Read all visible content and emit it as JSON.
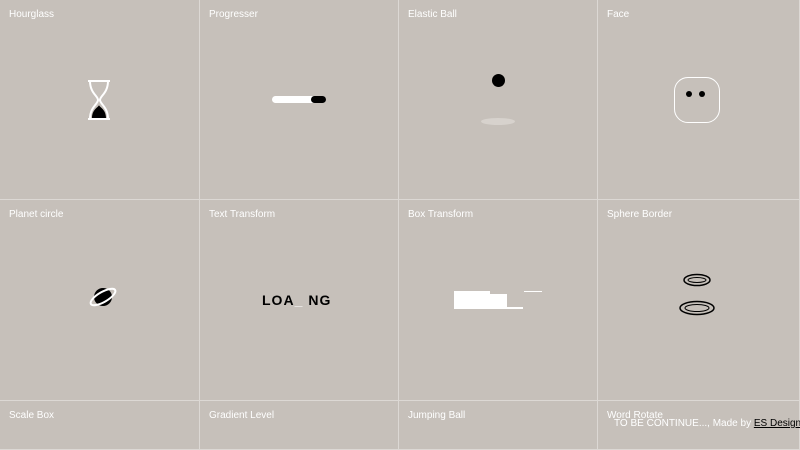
{
  "cells": [
    {
      "label": "Hourglass"
    },
    {
      "label": "Progresser"
    },
    {
      "label": "Elastic Ball"
    },
    {
      "label": "Face"
    },
    {
      "label": "Planet circle"
    },
    {
      "label": "Text Transform"
    },
    {
      "label": "Box Transform"
    },
    {
      "label": "Sphere Border"
    },
    {
      "label": "Scale Box"
    },
    {
      "label": "Gradient Level"
    },
    {
      "label": "Jumping Ball"
    },
    {
      "label": "Word Rotate"
    }
  ],
  "text_transform": {
    "left": "LOA",
    "under": "_",
    "right": "NG"
  },
  "footer": {
    "text": "TO BE CONTINUE..., Made by ",
    "link": "ES Design"
  },
  "colors": {
    "background": "#c6c0ba",
    "divider": "#dcd8d4",
    "label": "#ffffff",
    "ink": "#000000"
  }
}
